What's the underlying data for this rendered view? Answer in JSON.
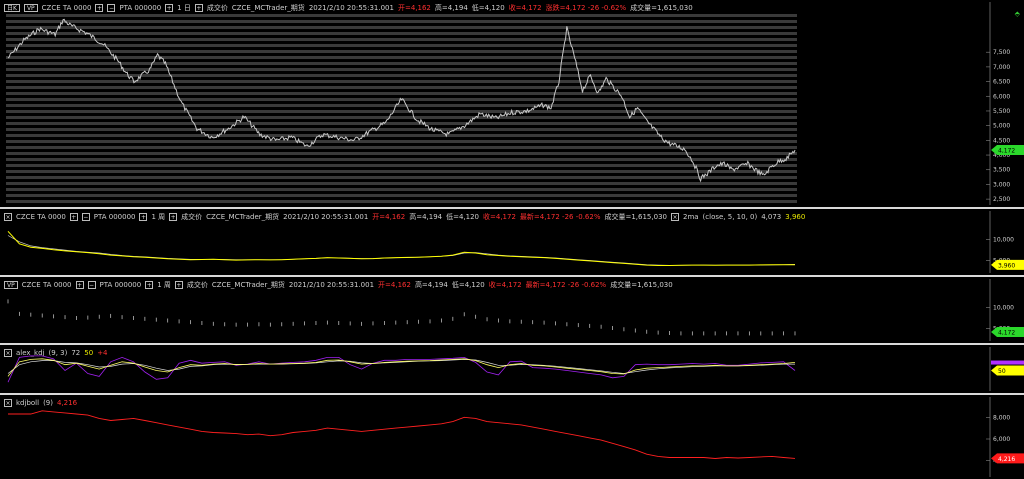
{
  "header_main": {
    "controls": [
      "日K",
      "VP"
    ],
    "contract": "CZCE TA 0000",
    "contract2": "PTA 000000",
    "period": "1 日",
    "field": "成交价",
    "source": "CZCE_MCTrader_期货",
    "datetime": "2021/2/10  20:55:31.001",
    "open": "开=4,162",
    "high": "高=4,194",
    "low": "低=4,120",
    "close": "收=4,172",
    "change": "涨跌=4,172 -26 -0.62%",
    "volume": "成交量=1,615,030"
  },
  "header_ma": {
    "contract": "CZCE TA 0000",
    "contract2": "PTA 000000",
    "period": "1 周",
    "field": "成交价",
    "source": "CZCE_MCTrader_期货",
    "datetime": "2021/2/10  20:55:31.001",
    "open": "开=4,162",
    "high": "高=4,194",
    "low": "低=4,120",
    "close": "收=4,172",
    "change": "最新=4,172 -26 -0.62%",
    "volume": "成交量=1,615,030",
    "indicator": "2ma",
    "params": "(close, 5, 10, 0)",
    "v1": "4,073",
    "v2": "3,960"
  },
  "header_vol": {
    "contract": "CZCE TA 0000",
    "contract2": "PTA 000000",
    "period": "1 周",
    "field": "成交价",
    "source": "CZCE_MCTrader_期货",
    "datetime": "2021/2/10  20:55:31.001",
    "open": "开=4,162",
    "high": "高=4,194",
    "low": "低=4,120",
    "close": "收=4,172",
    "change": "最新=4,172 -26 -0.62%",
    "volume": "成交量=1,615,030"
  },
  "header_kdj": {
    "indicator": "alex_kdj",
    "params": "(9, 3)",
    "v1": "72",
    "v2": "50",
    "v3": "+4"
  },
  "header_boll": {
    "indicator": "kdjboll",
    "params": "(9)",
    "v1": "4,216"
  },
  "tags": {
    "main": "4,172",
    "ma": "3,960",
    "vol": "4,172",
    "kdj": "50",
    "boll": "4,216"
  },
  "colors": {
    "price": "#c8c8c8",
    "ma_fast": "#ffff00",
    "ma_slow": "#d0d0d0",
    "kdj_k": "#ffff66",
    "kdj_d": "#e0e0e0",
    "kdj_j": "#a020f0",
    "boll": "#ff2020",
    "tag_green": "#2bd82b",
    "tag_yellow": "#ffff00",
    "tag_red": "#ff1a1a",
    "tag_purple": "#b030ff"
  },
  "chart_data": [
    {
      "type": "line",
      "name": "price",
      "x_range": [
        0,
        100
      ],
      "ylim": [
        2300,
        8800
      ],
      "yticks": [
        "2,500",
        "3,000",
        "3,500",
        "4,000",
        "4,500",
        "5,000",
        "5,500",
        "6,000",
        "6,500",
        "7,000",
        "7,500"
      ],
      "x": [
        0,
        2,
        4,
        6,
        7,
        8,
        10,
        12,
        14,
        15,
        16,
        18,
        19,
        20,
        22,
        24,
        26,
        28,
        30,
        32,
        34,
        36,
        38,
        40,
        42,
        44,
        46,
        48,
        50,
        52,
        54,
        56,
        58,
        60,
        62,
        64,
        66,
        68,
        69,
        70,
        71,
        72,
        73,
        74,
        75,
        76,
        77,
        78,
        79,
        80,
        81,
        82,
        83,
        84,
        85,
        86,
        87,
        88,
        89,
        90,
        91,
        92,
        93,
        94,
        95,
        96,
        97,
        98,
        99,
        100
      ],
      "values": [
        7300,
        7900,
        8300,
        8100,
        8600,
        8400,
        8150,
        7800,
        7200,
        6800,
        6500,
        6900,
        7400,
        7100,
        5800,
        4900,
        4600,
        4900,
        5300,
        4700,
        4500,
        4600,
        4300,
        4700,
        4600,
        4500,
        4800,
        5100,
        5900,
        5200,
        4850,
        4700,
        5000,
        5400,
        5250,
        5450,
        5500,
        5700,
        5600,
        6500,
        8300,
        7300,
        6200,
        6700,
        6100,
        6600,
        6300,
        6000,
        5300,
        5600,
        5200,
        4900,
        4600,
        4400,
        4300,
        4200,
        3800,
        3200,
        3400,
        3650,
        3700,
        3500,
        3600,
        3700,
        3500,
        3300,
        3600,
        3800,
        3900,
        4172
      ]
    },
    {
      "type": "line",
      "name": "2ma",
      "ylim": [
        2000,
        14000
      ],
      "yticks": [
        "5,000",
        "10,000"
      ],
      "fast_values": [
        12000,
        9000,
        8200,
        7900,
        7600,
        7300,
        7100,
        6900,
        6600,
        6300,
        6100,
        5900,
        5800,
        5600,
        5400,
        5300,
        5200,
        5250,
        5300,
        5200,
        5100,
        5150,
        5200,
        5150,
        5200,
        5300,
        5400,
        5500,
        5700,
        5600,
        5500,
        5400,
        5450,
        5600,
        5700,
        5750,
        5800,
        5900,
        6000,
        6300,
        7000,
        6800,
        6400,
        6200,
        6000,
        5900,
        5800,
        5700,
        5500,
        5300,
        5100,
        4900,
        4700,
        4500,
        4300,
        4100,
        3900,
        3800,
        3800,
        3850,
        3900,
        3900,
        3850,
        3900,
        3900,
        3900,
        3950,
        3960,
        3960,
        3960
      ],
      "slow_values": [
        11000,
        9500,
        8500,
        8100,
        7800,
        7500,
        7200,
        7000,
        6800,
        6500,
        6200,
        6000,
        5900,
        5700,
        5500,
        5400,
        5300,
        5300,
        5300,
        5250,
        5200,
        5200,
        5200,
        5200,
        5200,
        5300,
        5400,
        5500,
        5650,
        5650,
        5550,
        5450,
        5450,
        5550,
        5650,
        5700,
        5800,
        5900,
        6000,
        6200,
        6800,
        6900,
        6600,
        6300,
        6100,
        6000,
        5900,
        5750,
        5600,
        5400,
        5200,
        5000,
        4800,
        4600,
        4400,
        4200,
        4000,
        3900,
        3850,
        3850,
        3880,
        3900,
        3880,
        3890,
        3900,
        3900,
        3920,
        3940,
        4000,
        4073
      ]
    },
    {
      "type": "bar",
      "name": "volume",
      "ylim": [
        2000,
        14000
      ],
      "yticks": [
        "5,000",
        "10,000"
      ],
      "values": [
        12000,
        9000,
        8800,
        8600,
        8400,
        8200,
        8000,
        8100,
        8300,
        8500,
        8200,
        8000,
        7800,
        7600,
        7400,
        7200,
        7000,
        6800,
        6600,
        6500,
        6400,
        6400,
        6500,
        6400,
        6500,
        6600,
        6700,
        6800,
        6900,
        6800,
        6700,
        6600,
        6700,
        6800,
        6900,
        7000,
        7100,
        7200,
        7400,
        7800,
        8900,
        8300,
        7700,
        7400,
        7200,
        7100,
        7000,
        6900,
        6700,
        6500,
        6300,
        6100,
        5900,
        5600,
        5300,
        5000,
        4700,
        4500,
        4400,
        4300,
        4300,
        4300,
        4300,
        4300,
        4300,
        4300,
        4300,
        4300,
        4300,
        4300
      ]
    },
    {
      "type": "line",
      "name": "alex_kdj",
      "ylim": [
        -20,
        110
      ],
      "k_values": [
        30,
        80,
        88,
        90,
        85,
        70,
        75,
        65,
        55,
        68,
        80,
        75,
        62,
        50,
        45,
        60,
        70,
        68,
        72,
        74,
        70,
        71,
        74,
        72,
        73,
        74,
        75,
        78,
        85,
        86,
        80,
        72,
        74,
        78,
        80,
        82,
        83,
        84,
        86,
        88,
        90,
        84,
        70,
        60,
        70,
        74,
        68,
        66,
        62,
        58,
        54,
        50,
        46,
        40,
        38,
        52,
        58,
        60,
        62,
        64,
        66,
        66,
        68,
        66,
        66,
        68,
        70,
        72,
        74,
        78
      ],
      "d_values": [
        40,
        70,
        80,
        84,
        84,
        78,
        76,
        70,
        62,
        64,
        72,
        74,
        68,
        58,
        50,
        55,
        64,
        66,
        70,
        72,
        71,
        71,
        72,
        72,
        72,
        73,
        74,
        76,
        80,
        83,
        82,
        76,
        74,
        76,
        78,
        80,
        82,
        83,
        84,
        86,
        88,
        86,
        78,
        68,
        68,
        71,
        70,
        68,
        65,
        61,
        57,
        53,
        49,
        44,
        40,
        46,
        52,
        56,
        59,
        61,
        63,
        64,
        66,
        66,
        66,
        67,
        68,
        70,
        72,
        72
      ],
      "j_values": [
        10,
        95,
        100,
        100,
        90,
        50,
        75,
        40,
        30,
        80,
        95,
        80,
        45,
        20,
        25,
        75,
        85,
        75,
        78,
        80,
        68,
        72,
        80,
        72,
        75,
        78,
        80,
        85,
        95,
        95,
        70,
        55,
        75,
        85,
        85,
        88,
        88,
        88,
        90,
        92,
        95,
        78,
        45,
        35,
        80,
        82,
        60,
        58,
        55,
        50,
        45,
        40,
        35,
        25,
        30,
        70,
        72,
        70,
        70,
        72,
        74,
        72,
        74,
        68,
        68,
        72,
        76,
        78,
        80,
        50
      ]
    },
    {
      "type": "line",
      "name": "kdjboll",
      "ylim": [
        2500,
        9500
      ],
      "yticks": [
        "4,000",
        "6,000",
        "8,000"
      ],
      "values": [
        8300,
        8300,
        8300,
        8600,
        8500,
        8400,
        8300,
        8200,
        7900,
        7700,
        7800,
        7900,
        7700,
        7500,
        7300,
        7100,
        6900,
        6700,
        6600,
        6550,
        6500,
        6400,
        6450,
        6300,
        6400,
        6600,
        6700,
        6800,
        7000,
        6900,
        6800,
        6700,
        6800,
        6900,
        7000,
        7100,
        7200,
        7300,
        7400,
        7600,
        8000,
        7900,
        7600,
        7500,
        7400,
        7300,
        7100,
        6900,
        6700,
        6500,
        6300,
        6100,
        5900,
        5600,
        5300,
        5000,
        4600,
        4400,
        4300,
        4300,
        4300,
        4300,
        4200,
        4300,
        4250,
        4300,
        4350,
        4400,
        4300,
        4216
      ]
    }
  ]
}
